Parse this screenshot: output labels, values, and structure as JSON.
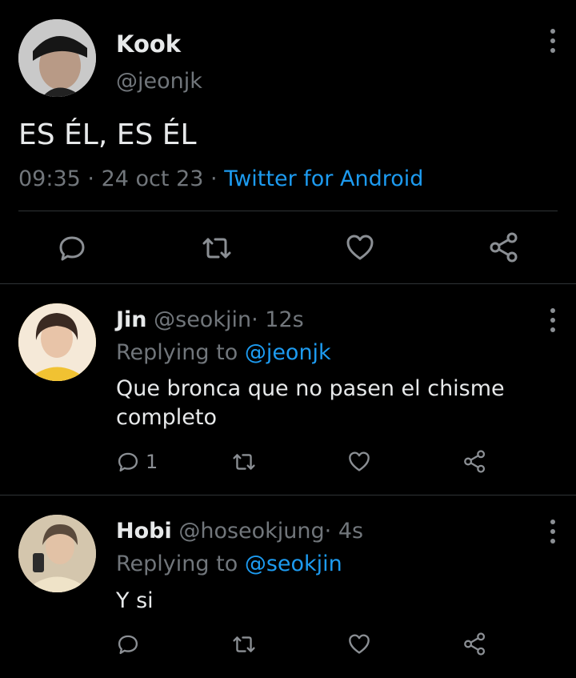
{
  "main_tweet": {
    "display_name": "Kook",
    "handle": "@jeonjk",
    "text": "ES ÉL, ES ÉL",
    "time": "09:35",
    "date": "24 oct 23",
    "separator": "·",
    "source": "Twitter for Android",
    "more_icon": "more-vertical-icon",
    "actions": [
      "reply-icon",
      "retweet-icon",
      "like-icon",
      "share-icon"
    ]
  },
  "replies": [
    {
      "display_name": "Jin",
      "handle": "@seokjin",
      "age": "12s",
      "separator": "·",
      "replying_prefix": "Replying to",
      "replying_to": "@jeonjk",
      "text_line1": "Que bronca que no pasen el chisme",
      "text_line2": "completo",
      "reply_count": "1"
    },
    {
      "display_name": "Hobi",
      "handle": "@hoseokjung",
      "age": "4s",
      "separator": "·",
      "replying_prefix": "Replying to",
      "replying_to": "@seokjin",
      "text_line1": "Y si",
      "reply_count": ""
    }
  ],
  "colors": {
    "background": "#000000",
    "text": "#e7e9ea",
    "muted": "#71767b",
    "link": "#1d9bf0",
    "divider": "#2f3336"
  }
}
